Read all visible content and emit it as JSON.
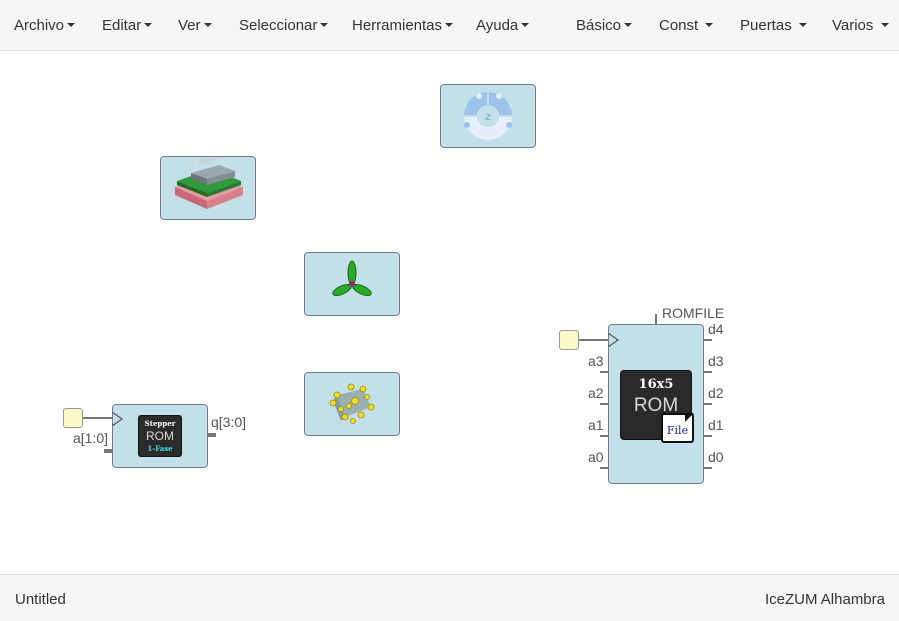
{
  "menu": {
    "left": [
      "Archivo",
      "Editar",
      "Ver",
      "Seleccionar",
      "Herramientas",
      "Ayuda"
    ],
    "right": [
      "Básico",
      "Const",
      "Puertas",
      "Varios"
    ]
  },
  "blocks": {
    "rom_small": {
      "chip_title": "Stepper",
      "chip_main": "ROM",
      "chip_sub": "1-Fase",
      "in_label": "a[1:0]",
      "out_label": "q[3:0]"
    },
    "rom_large": {
      "param_label": "ROMFILE",
      "chip_title": "16x5",
      "chip_main": "ROM",
      "file_label": "File",
      "inputs": [
        "a3",
        "a2",
        "a1",
        "a0"
      ],
      "outputs": [
        "d4",
        "d3",
        "d2",
        "d1",
        "d0"
      ]
    }
  },
  "footer": {
    "file_name": "Untitled",
    "board": "IceZUM Alhambra"
  },
  "colors": {
    "block_fill": "#c3dfe9",
    "input_fill": "#fafac8",
    "chip_body": "#2a2a2a"
  }
}
